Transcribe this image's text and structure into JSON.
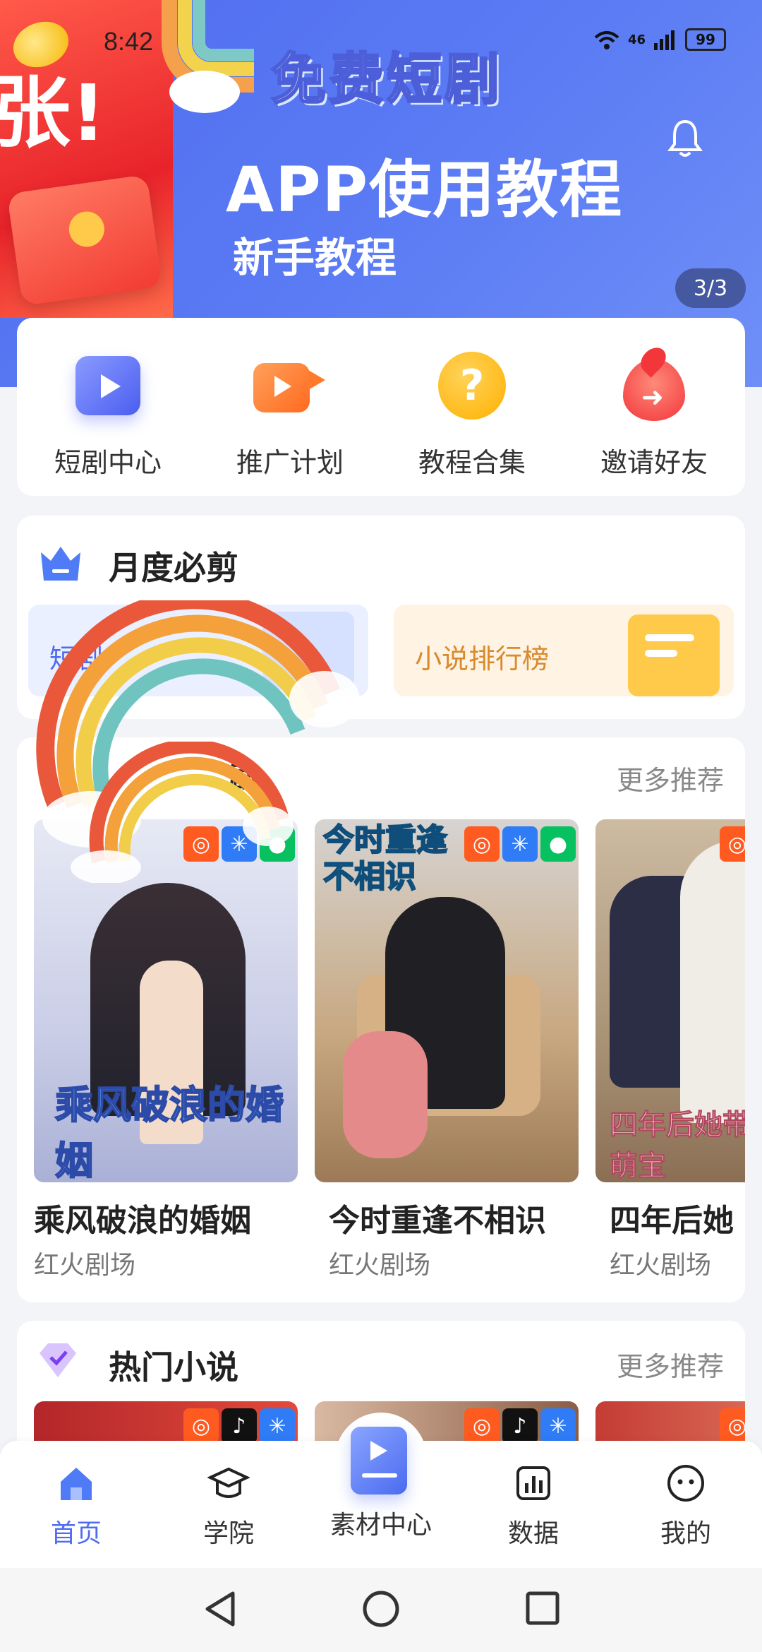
{
  "status_bar": {
    "time": "8:42",
    "network": "46",
    "battery": "99"
  },
  "banner": {
    "left_card_text": "张!",
    "badge": "免费短剧",
    "title": "APP使用教程",
    "subtitle": "新手教程",
    "pager": "3/3"
  },
  "quick_menu": [
    {
      "label": "短剧中心",
      "icon": "play-card-icon"
    },
    {
      "label": "推广计划",
      "icon": "video-camera-icon"
    },
    {
      "label": "教程合集",
      "icon": "question-bubble-icon"
    },
    {
      "label": "邀请好友",
      "icon": "share-flame-icon"
    }
  ],
  "monthly": {
    "title": "月度必剪",
    "ranks": [
      {
        "label": "短剧"
      },
      {
        "label": "小说排行榜"
      }
    ]
  },
  "drama": {
    "title": "剧",
    "more": "更多推荐",
    "items": [
      {
        "title": "乘风破浪的婚姻",
        "source": "红火剧场",
        "poster_text": "乘风破浪的婚姻"
      },
      {
        "title": "今时重逢不相识",
        "source": "红火剧场",
        "poster_text": "今时重逢不相识"
      },
      {
        "title": "四年后她",
        "source": "红火剧场",
        "poster_text": "四年后她带萌宝"
      }
    ]
  },
  "novel": {
    "title": "热门小说",
    "more": "更多推荐"
  },
  "bottom_nav": [
    {
      "label": "首页",
      "active": true
    },
    {
      "label": "学院",
      "active": false
    },
    {
      "label": "素材中心",
      "active": false
    },
    {
      "label": "数据",
      "active": false
    },
    {
      "label": "我的",
      "active": false
    }
  ],
  "colors": {
    "accent": "#4f6cf0",
    "banner_bg": "#5b7cf4",
    "kuaishou": "#ff5a1f",
    "wechat": "#07c160",
    "douyin": "#111111",
    "star": "#2f7cf6"
  }
}
